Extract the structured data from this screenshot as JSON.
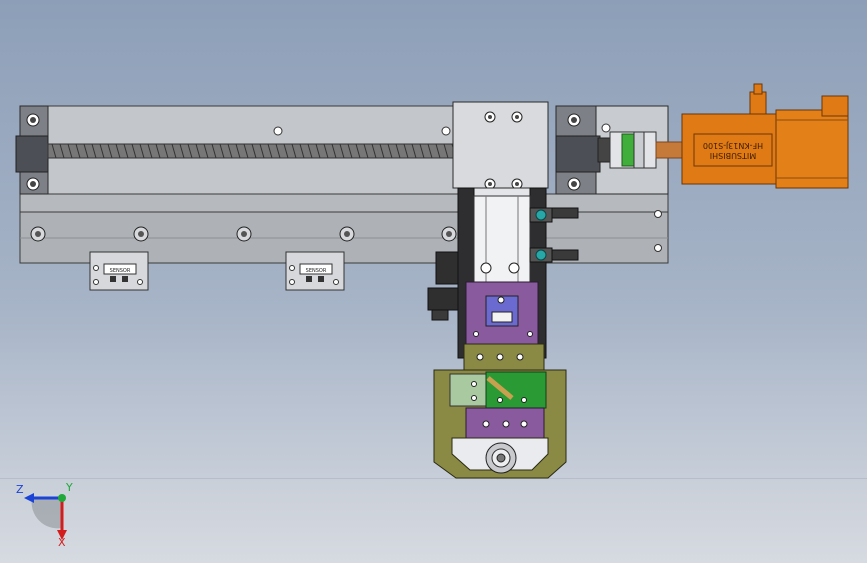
{
  "motor": {
    "label_line1": "MITSUBISHI",
    "label_line2": "HF-KN13J-S100"
  },
  "sensor_labels": {
    "left": "SENSOR",
    "right": "SENSOR"
  },
  "triad": {
    "z_label": "Z",
    "y_label": "Y",
    "x_label": "X"
  },
  "colors": {
    "motor_orange": "#e07a14",
    "rail_gray": "#b5b8bd",
    "purple_block": "#8a5a9e",
    "olive_block": "#8a8a45",
    "green_block": "#2a9a35",
    "coupling_green": "#3fae3a",
    "axis_z": "#1b43d6",
    "axis_x": "#d31d1d",
    "axis_y": "#21a83a"
  }
}
